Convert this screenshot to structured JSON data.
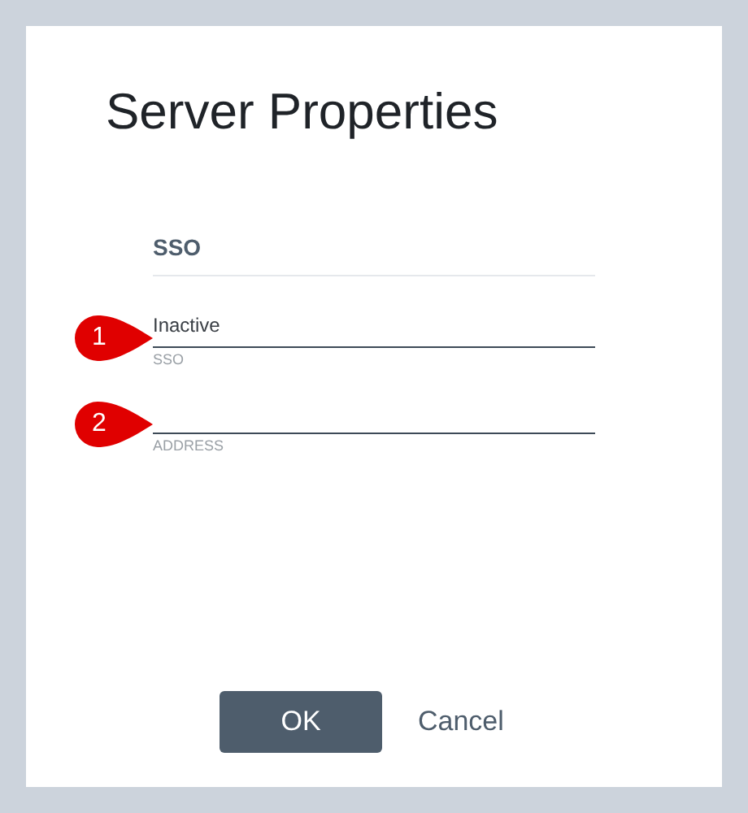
{
  "dialog": {
    "title": "Server Properties"
  },
  "section": {
    "heading": "SSO"
  },
  "fields": [
    {
      "callout": "1",
      "value": "Inactive",
      "helper": "SSO"
    },
    {
      "callout": "2",
      "helper": "ADDRESS"
    }
  ],
  "buttons": [
    {
      "label": "OK",
      "kind": "primary"
    },
    {
      "label": "Cancel",
      "kind": "link"
    }
  ]
}
